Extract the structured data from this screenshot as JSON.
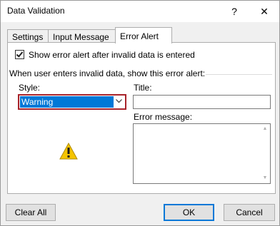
{
  "window": {
    "title": "Data Validation",
    "help_glyph": "?",
    "close_glyph": "✕"
  },
  "tabs": [
    {
      "label": "Settings",
      "active": false
    },
    {
      "label": "Input Message",
      "active": false
    },
    {
      "label": "Error Alert",
      "active": true
    }
  ],
  "error_alert": {
    "show_alert_checkbox": {
      "label": "Show error alert after invalid data is entered",
      "checked": true
    },
    "group_label": "When user enters invalid data, show this error alert:",
    "style": {
      "label": "Style:",
      "value": "Warning"
    },
    "title_field": {
      "label": "Title:",
      "value": ""
    },
    "error_message_field": {
      "label": "Error message:",
      "value": ""
    },
    "icon": "warning-triangle-icon"
  },
  "buttons": {
    "clear_all": "Clear All",
    "ok": "OK",
    "cancel": "Cancel"
  },
  "colors": {
    "highlight": "#0078d7",
    "style_border": "#a8232a",
    "warning_yellow": "#f5c400"
  }
}
